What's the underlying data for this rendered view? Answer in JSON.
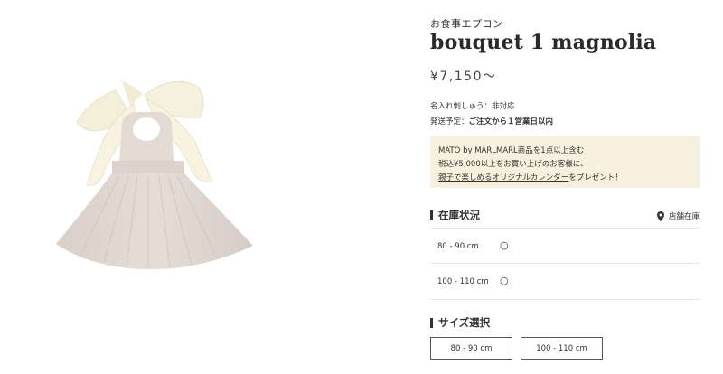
{
  "product": {
    "category": "お食事エプロン",
    "title": "bouquet 1 magnolia",
    "price": "¥7,150〜",
    "name_print_label": "名入れ刺しゅう：",
    "name_print_value": "非対応",
    "ship_label": "発送予定：",
    "ship_value": "ご注文から１営業日以内"
  },
  "promo": {
    "line1": "MATO by MARLMARL商品を1点以上含む",
    "line2": "税込¥5,000以上をお買い上げのお客様に、",
    "line3_link": "親子で楽しめるオリジナルカレンダー",
    "line3_suffix": "をプレゼント！",
    "bg_color": "#f7f0de"
  },
  "stock": {
    "title": "在庫状況",
    "store_link": "店舗在庫",
    "store_icon": "map-pin-icon",
    "rows": [
      {
        "size": "80 - 90 cm",
        "status": "○"
      },
      {
        "size": "100 - 110 cm",
        "status": "○"
      }
    ]
  },
  "size_select": {
    "title": "サイズ選択",
    "options": [
      "80 - 90 cm",
      "100 - 110 cm"
    ]
  }
}
